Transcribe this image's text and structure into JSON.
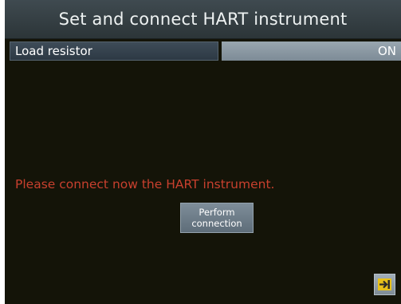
{
  "header": {
    "title": "Set and connect HART instrument"
  },
  "parameter": {
    "label": "Load resistor",
    "value": "ON"
  },
  "main": {
    "message": "Please connect now the HART instrument.",
    "message_color": "#c8402e",
    "perform_button": {
      "line1": "Perform",
      "line2": "connection"
    }
  },
  "footer": {
    "exit_icon": "exit-icon",
    "icon_color": "#e8c11a"
  }
}
